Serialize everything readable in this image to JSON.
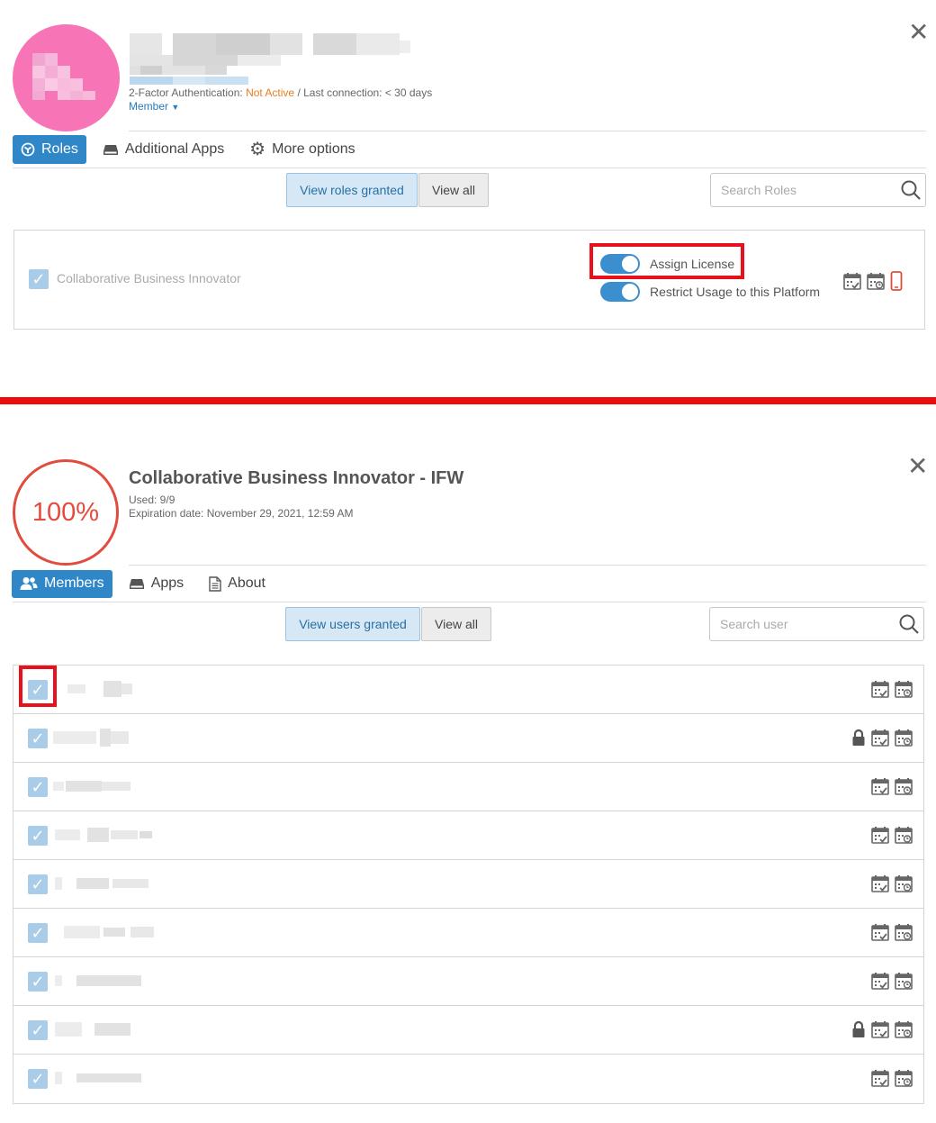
{
  "top_panel": {
    "user_meta": {
      "twofa_label": "2-Factor Authentication: ",
      "twofa_status": "Not Active",
      "last_connection": " / Last connection: < 30 days",
      "member_label": "Member"
    },
    "tabs": [
      {
        "label": "Roles",
        "icon": "roles-icon",
        "active": true
      },
      {
        "label": "Additional Apps",
        "icon": "drive-icon",
        "active": false
      },
      {
        "label": "More options",
        "icon": "gear-icon",
        "active": false
      }
    ],
    "view_buttons": {
      "granted": "View roles granted",
      "all": "View all"
    },
    "search": {
      "placeholder": "Search Roles"
    },
    "role": {
      "name": "Collaborative Business Innovator",
      "toggles": [
        {
          "label": "Assign License",
          "on": true
        },
        {
          "label": "Restrict Usage to this Platform",
          "on": true
        }
      ]
    }
  },
  "bottom_panel": {
    "license": {
      "percent": "100%",
      "title": "Collaborative Business Innovator - IFW",
      "used": "Used: 9/9",
      "expiration": "Expiration date: November 29, 2021, 12:59 AM"
    },
    "tabs": [
      {
        "label": "Members",
        "icon": "members-icon",
        "active": true
      },
      {
        "label": "Apps",
        "icon": "drive-icon",
        "active": false
      },
      {
        "label": "About",
        "icon": "document-icon",
        "active": false
      }
    ],
    "view_buttons": {
      "granted": "View users granted",
      "all": "View all"
    },
    "search": {
      "placeholder": "Search user"
    },
    "members": [
      {
        "locked": false
      },
      {
        "locked": true
      },
      {
        "locked": false
      },
      {
        "locked": false
      },
      {
        "locked": false
      },
      {
        "locked": false
      },
      {
        "locked": false
      },
      {
        "locked": true
      },
      {
        "locked": false
      }
    ]
  },
  "colors": {
    "accent": "#2f87c7",
    "warning": "#e67e22",
    "license_ring": "#e24c3f",
    "annotation_red": "#e8101a",
    "avatar": "#f774b7"
  }
}
